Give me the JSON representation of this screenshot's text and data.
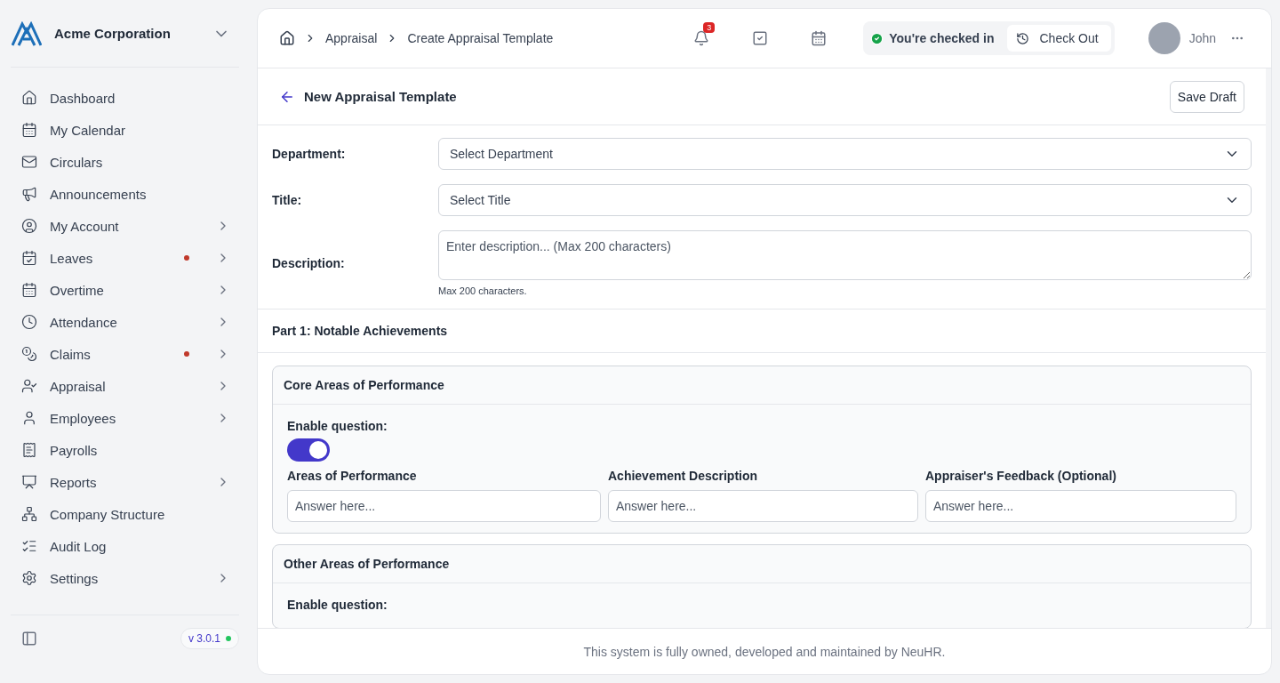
{
  "company": {
    "name": "Acme Corporation"
  },
  "sidebar": {
    "items": [
      {
        "label": "Dashboard",
        "expandable": false,
        "alert": false
      },
      {
        "label": "My Calendar",
        "expandable": false,
        "alert": false
      },
      {
        "label": "Circulars",
        "expandable": false,
        "alert": false
      },
      {
        "label": "Announcements",
        "expandable": false,
        "alert": false
      },
      {
        "label": "My Account",
        "expandable": true,
        "alert": false
      },
      {
        "label": "Leaves",
        "expandable": true,
        "alert": true
      },
      {
        "label": "Overtime",
        "expandable": true,
        "alert": false
      },
      {
        "label": "Attendance",
        "expandable": true,
        "alert": false
      },
      {
        "label": "Claims",
        "expandable": true,
        "alert": true
      },
      {
        "label": "Appraisal",
        "expandable": true,
        "alert": false
      },
      {
        "label": "Employees",
        "expandable": true,
        "alert": false
      },
      {
        "label": "Payrolls",
        "expandable": false,
        "alert": false
      },
      {
        "label": "Reports",
        "expandable": true,
        "alert": false
      },
      {
        "label": "Company Structure",
        "expandable": false,
        "alert": false
      },
      {
        "label": "Audit Log",
        "expandable": false,
        "alert": false
      },
      {
        "label": "Settings",
        "expandable": true,
        "alert": false
      }
    ],
    "version": "v 3.0.1"
  },
  "topbar": {
    "breadcrumb": [
      "Appraisal",
      "Create Appraisal Template"
    ],
    "notification_count": "3",
    "checkin_status": "You're checked in",
    "checkout_button": "Check Out",
    "user_name": "John"
  },
  "page": {
    "title": "New Appraisal Template",
    "save_button": "Save Draft"
  },
  "fields": [
    {
      "kind": "select",
      "label": "Department:",
      "placeholder": "Select Department"
    },
    {
      "kind": "select",
      "label": "Title:",
      "placeholder": "Select Title"
    },
    {
      "kind": "textarea",
      "label": "Description:",
      "placeholder": "Enter description... (Max 200 characters)",
      "hint": "Max 200 characters."
    }
  ],
  "part": {
    "title": "Part 1: Notable Achievements",
    "questions": [
      {
        "title": "Core Areas of Performance",
        "enable_label": "Enable question:",
        "enabled": true,
        "columns": [
          {
            "label": "Areas of Performance",
            "placeholder": "Answer here..."
          },
          {
            "label": "Achievement Description",
            "placeholder": "Answer here..."
          },
          {
            "label": "Appraiser's Feedback (Optional)",
            "placeholder": "Answer here..."
          }
        ]
      },
      {
        "title": "Other Areas of Performance",
        "enable_label": "Enable question:"
      }
    ]
  },
  "footer": "This system is fully owned, developed and maintained by NeuHR."
}
